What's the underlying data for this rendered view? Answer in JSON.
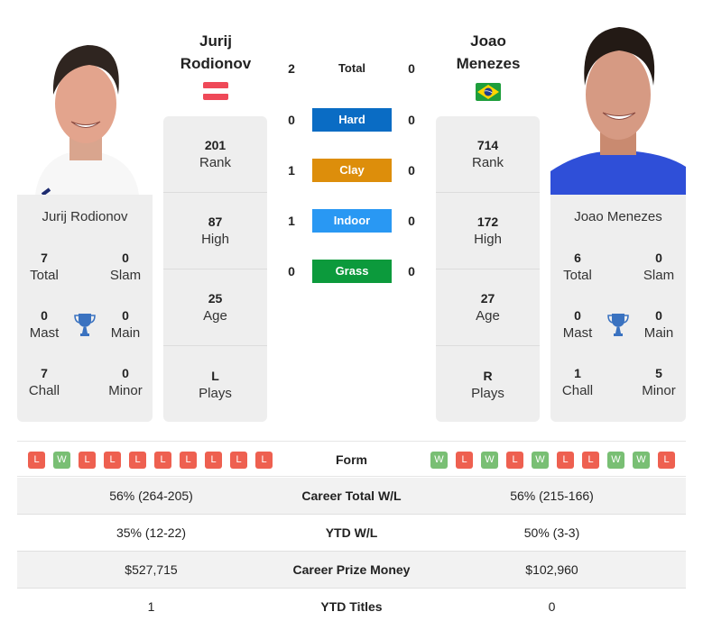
{
  "player1": {
    "name_line1": "Jurij",
    "name_line2": "Rodionov",
    "full_name": "Jurij Rodionov",
    "country_flag": "austria-flag",
    "flag_colors": [
      "#ed2939",
      "#ffffff",
      "#ed2939"
    ],
    "stats": [
      {
        "value": "201",
        "label": "Rank"
      },
      {
        "value": "87",
        "label": "High"
      },
      {
        "value": "25",
        "label": "Age"
      },
      {
        "value": "L",
        "label": "Plays"
      }
    ],
    "titles": {
      "total": {
        "value": "7",
        "label": "Total"
      },
      "slam": {
        "value": "0",
        "label": "Slam"
      },
      "mast": {
        "value": "0",
        "label": "Mast"
      },
      "main": {
        "value": "0",
        "label": "Main"
      },
      "chall": {
        "value": "7",
        "label": "Chall"
      },
      "minor": {
        "value": "0",
        "label": "Minor"
      }
    },
    "form": [
      "L",
      "W",
      "L",
      "L",
      "L",
      "L",
      "L",
      "L",
      "L",
      "L"
    ],
    "career_total_wl": "56% (264-205)",
    "ytd_wl": "35% (12-22)",
    "career_prize_money": "$527,715",
    "ytd_titles": "1"
  },
  "player2": {
    "name_line1": "Joao",
    "name_line2": "Menezes",
    "full_name": "Joao Menezes",
    "country_flag": "brazil-flag",
    "flag_colors": [
      "#009c3b",
      "#ffdf00",
      "#002776"
    ],
    "stats": [
      {
        "value": "714",
        "label": "Rank"
      },
      {
        "value": "172",
        "label": "High"
      },
      {
        "value": "27",
        "label": "Age"
      },
      {
        "value": "R",
        "label": "Plays"
      }
    ],
    "titles": {
      "total": {
        "value": "6",
        "label": "Total"
      },
      "slam": {
        "value": "0",
        "label": "Slam"
      },
      "mast": {
        "value": "0",
        "label": "Mast"
      },
      "main": {
        "value": "0",
        "label": "Main"
      },
      "chall": {
        "value": "1",
        "label": "Chall"
      },
      "minor": {
        "value": "5",
        "label": "Minor"
      }
    },
    "form": [
      "W",
      "L",
      "W",
      "L",
      "W",
      "L",
      "L",
      "W",
      "W",
      "L"
    ],
    "career_total_wl": "56% (215-166)",
    "ytd_wl": "50% (3-3)",
    "career_prize_money": "$102,960",
    "ytd_titles": "0"
  },
  "h2h": [
    {
      "label": "Total",
      "p1": "2",
      "p2": "0",
      "color": ""
    },
    {
      "label": "Hard",
      "p1": "0",
      "p2": "0",
      "color": "#0a6cc4"
    },
    {
      "label": "Clay",
      "p1": "1",
      "p2": "0",
      "color": "#dd8e0b"
    },
    {
      "label": "Indoor",
      "p1": "1",
      "p2": "0",
      "color": "#2998f3"
    },
    {
      "label": "Grass",
      "p1": "0",
      "p2": "0",
      "color": "#0c9a3c"
    }
  ],
  "comparison": {
    "form_label": "Form",
    "rows": [
      {
        "label": "Career Total W/L"
      },
      {
        "label": "YTD W/L"
      },
      {
        "label": "Career Prize Money"
      },
      {
        "label": "YTD Titles"
      }
    ]
  },
  "colors": {
    "loss": "#ee6050",
    "win": "#79bf74",
    "trophy": "#3a72c0"
  }
}
